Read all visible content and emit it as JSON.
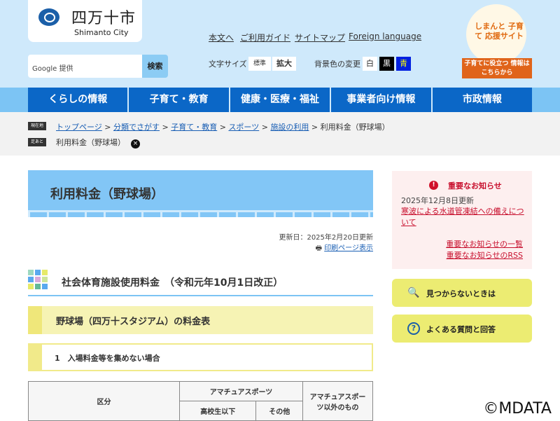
{
  "logo": {
    "jp": "四万十市",
    "en": "Shimanto City"
  },
  "util_links": [
    "本文へ",
    "ご利用ガイド",
    "サイトマップ",
    "Foreign language"
  ],
  "search": {
    "placeholder": "Google 提供",
    "button": "検索"
  },
  "font_size": {
    "label": "文字サイズ",
    "standard": "標準",
    "large": "拡大"
  },
  "bg_color": {
    "label": "背景色の変更",
    "white": "白",
    "black": "黒",
    "blue": "青"
  },
  "banner": {
    "title": "しまんと 子育て 応援サイト",
    "caption": "子育てに役立つ 情報はこちらから"
  },
  "nav": [
    "くらしの情報",
    "子育て・教育",
    "健康・医療・福祉",
    "事業者向け情報",
    "市政情報"
  ],
  "breadcrumb": {
    "tag": "現在地",
    "items": [
      "トップページ",
      "分類でさがす",
      "子育て・教育",
      "スポーツ",
      "施設の利用"
    ],
    "current": "利用料金（野球場）"
  },
  "footprint": {
    "tag": "足あと",
    "item": "利用料金（野球場）",
    "close": "×"
  },
  "page": {
    "title": "利用料金（野球場）",
    "updated": "更新日：2025年2月20日更新",
    "print": "印刷ページ表示",
    "h2": "社会体育施設使用料金　（令和元年10月1日改正）",
    "h3": "野球場（四万十スタジアム）の料金表",
    "h4": "1　入場料金等を集めない場合"
  },
  "table": {
    "col1": "区分",
    "col2": "アマチュアスポーツ",
    "col2a": "高校生以下",
    "col2b": "その他",
    "col3": "アマチュアスポーツ以外のもの"
  },
  "notice": {
    "title": "重要なお知らせ",
    "date": "2025年12月8日更新",
    "link": "寒波による水道管凍結への備えについて",
    "list": "重要なお知らせの一覧",
    "rss": "重要なお知らせのRSS"
  },
  "side_buttons": [
    "見つからないときは",
    "よくある質問と回答"
  ],
  "watermark": "©MDATA",
  "colors": {
    "nav": "#0b67c7",
    "header": "#cfe9fb",
    "notice": "#c8102e",
    "yellow": "#ecec72"
  }
}
